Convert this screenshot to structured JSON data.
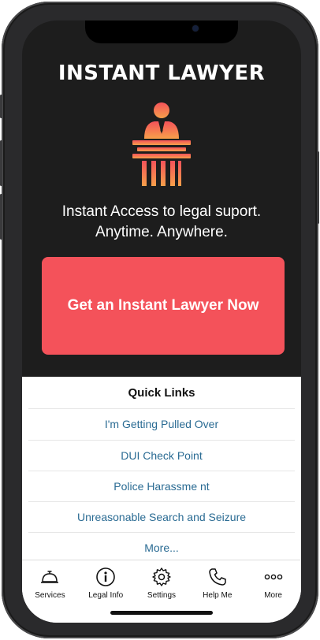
{
  "app": {
    "title": "INSTANT LAWYER",
    "tagline_line1": "Instant Access to legal suport.",
    "tagline_line2": "Anytime. Anywhere.",
    "cta_label": "Get an Instant Lawyer Now"
  },
  "quick_links": {
    "title": "Quick Links",
    "items": [
      {
        "label": "I'm Getting Pulled Over"
      },
      {
        "label": "DUI Check Point"
      },
      {
        "label": "Police Harassme nt"
      },
      {
        "label": "Unreasonable Search and Seizure"
      },
      {
        "label": "More..."
      }
    ]
  },
  "tabbar": {
    "items": [
      {
        "label": "Services",
        "icon": "bell-icon"
      },
      {
        "label": "Legal Info",
        "icon": "info-icon"
      },
      {
        "label": "Settings",
        "icon": "gear-icon"
      },
      {
        "label": "Help Me",
        "icon": "phone-icon"
      },
      {
        "label": "More",
        "icon": "more-icon"
      }
    ]
  },
  "colors": {
    "background": "#1d1d1d",
    "accent": "#f4525a",
    "link": "#2a6b93",
    "logo_gradient_top": "#f4525a",
    "logo_gradient_bottom": "#f7a04a"
  }
}
